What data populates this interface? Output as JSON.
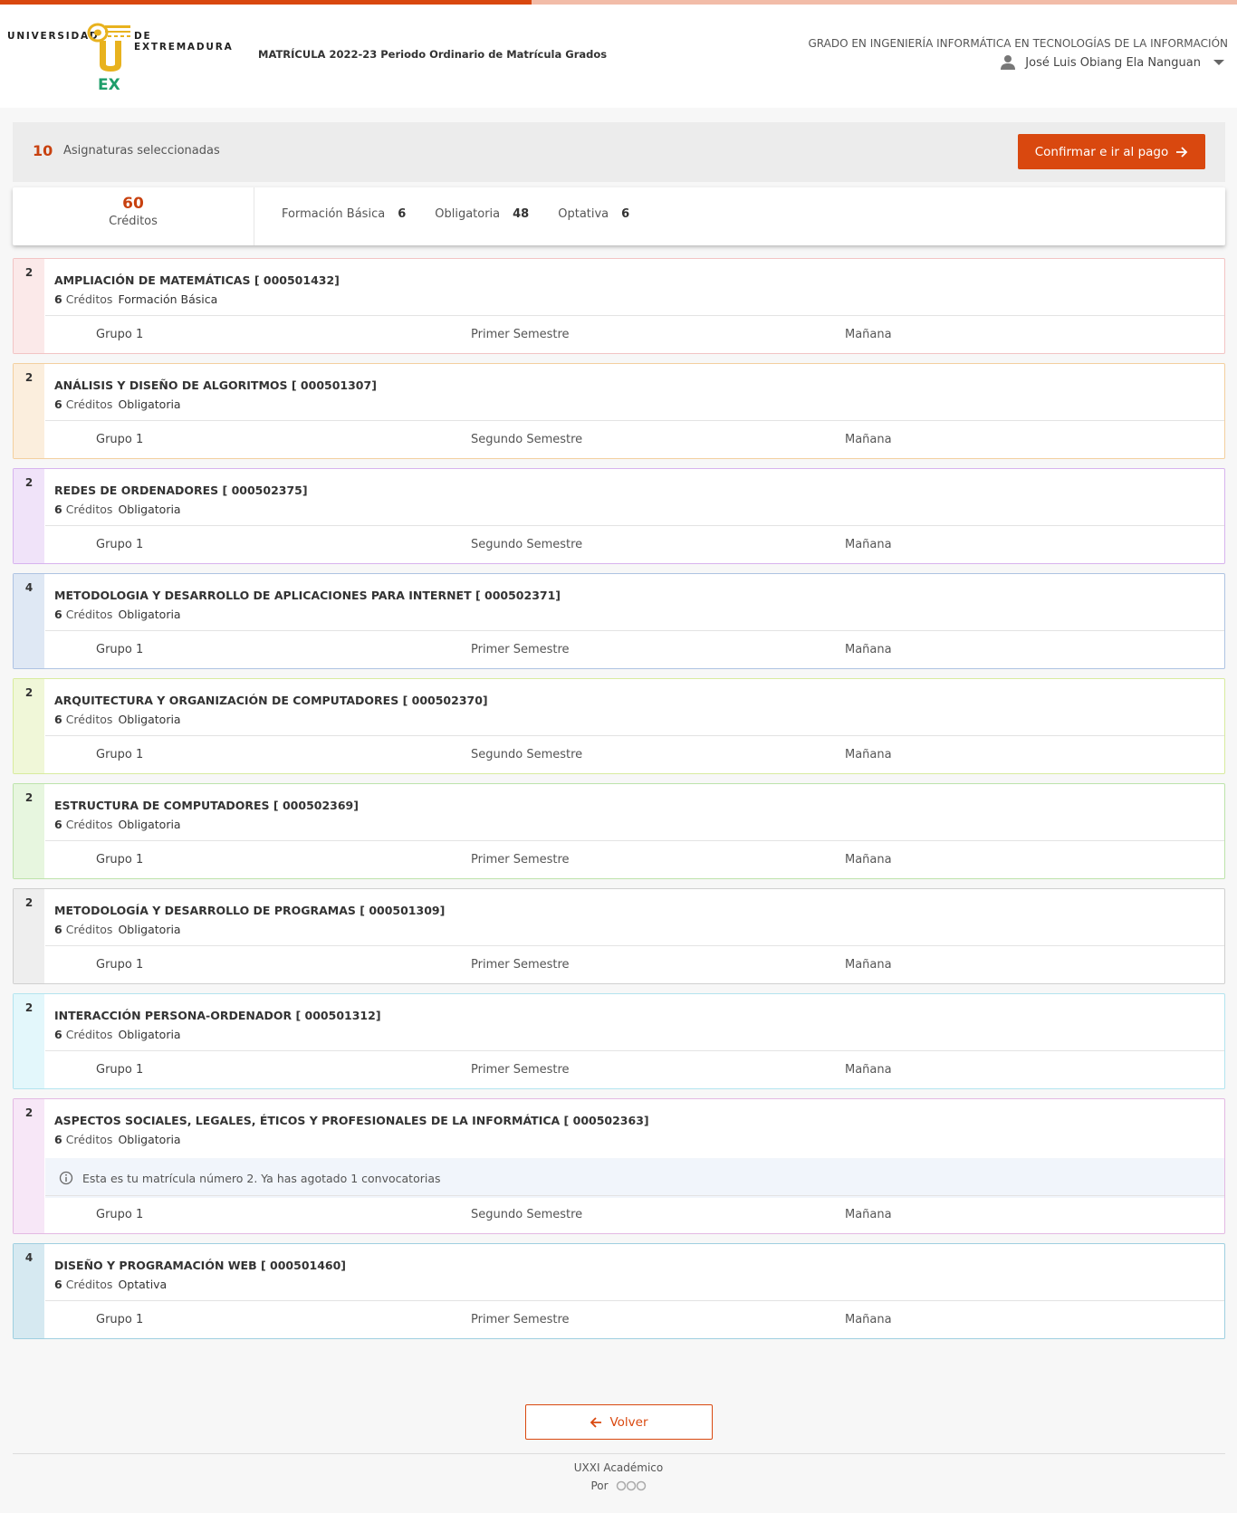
{
  "header": {
    "university_left": "UNIVERSIDAD",
    "university_right": "DE EXTREMADURA",
    "logo_letters": "EX",
    "matricula_title": "MATRÍCULA 2022-23 Periodo Ordinario de Matrícula Grados",
    "degree": "GRADO EN INGENIERÍA INFORMÁTICA EN TECNOLOGÍAS DE LA INFORMACIÓN",
    "user_name": "José Luis Obiang Ela Nanguan",
    "progress_fraction": 0.43
  },
  "summary": {
    "selected_count": "10",
    "selected_label": "Asignaturas seleccionadas",
    "confirm_label": "Confirmar e ir al pago"
  },
  "credits": {
    "total": "60",
    "total_label": "Créditos",
    "types": [
      {
        "label": "Formación Básica",
        "value": "6"
      },
      {
        "label": "Obligatoria",
        "value": "48"
      },
      {
        "label": "Optativa",
        "value": "6"
      }
    ]
  },
  "courses": [
    {
      "year": "2",
      "title": "AMPLIACIÓN DE MATEMÁTICAS [ 000501432]",
      "credits": "6",
      "credits_label": "Créditos",
      "type": "Formación Básica",
      "group": "Grupo 1",
      "semester": "Primer Semestre",
      "shift": "Mañana",
      "stripe_color": "#fbe9e9",
      "border_color": "#f2c4c4"
    },
    {
      "year": "2",
      "title": "ANÁLISIS Y DISEÑO DE ALGORITMOS [ 000501307]",
      "credits": "6",
      "credits_label": "Créditos",
      "type": "Obligatoria",
      "group": "Grupo 1",
      "semester": "Segundo Semestre",
      "shift": "Mañana",
      "stripe_color": "#fbeedd",
      "border_color": "#f3cf9f"
    },
    {
      "year": "2",
      "title": "REDES DE ORDENADORES [ 000502375]",
      "credits": "6",
      "credits_label": "Créditos",
      "type": "Obligatoria",
      "group": "Grupo 1",
      "semester": "Segundo Semestre",
      "shift": "Mañana",
      "stripe_color": "#f0e3f9",
      "border_color": "#d7b3ee"
    },
    {
      "year": "4",
      "title": "METODOLOGIA Y DESARROLLO DE APLICACIONES PARA INTERNET [ 000502371]",
      "credits": "6",
      "credits_label": "Créditos",
      "type": "Obligatoria",
      "group": "Grupo 1",
      "semester": "Primer Semestre",
      "shift": "Mañana",
      "stripe_color": "#dfe8f4",
      "border_color": "#aec3e2"
    },
    {
      "year": "2",
      "title": "ARQUITECTURA Y ORGANIZACIÓN DE COMPUTADORES [ 000502370]",
      "credits": "6",
      "credits_label": "Créditos",
      "type": "Obligatoria",
      "group": "Grupo 1",
      "semester": "Segundo Semestre",
      "shift": "Mañana",
      "stripe_color": "#f0f7d8",
      "border_color": "#d8eb9e"
    },
    {
      "year": "2",
      "title": "ESTRUCTURA DE COMPUTADORES [ 000502369]",
      "credits": "6",
      "credits_label": "Créditos",
      "type": "Obligatoria",
      "group": "Grupo 1",
      "semester": "Primer Semestre",
      "shift": "Mañana",
      "stripe_color": "#e7f6df",
      "border_color": "#bde3ab"
    },
    {
      "year": "2",
      "title": "METODOLOGÍA Y DESARROLLO DE PROGRAMAS [ 000501309]",
      "credits": "6",
      "credits_label": "Créditos",
      "type": "Obligatoria",
      "group": "Grupo 1",
      "semester": "Primer Semestre",
      "shift": "Mañana",
      "stripe_color": "#eeeeee",
      "border_color": "#cfcfcf"
    },
    {
      "year": "2",
      "title": "INTERACCIÓN PERSONA-ORDENADOR [ 000501312]",
      "credits": "6",
      "credits_label": "Créditos",
      "type": "Obligatoria",
      "group": "Grupo 1",
      "semester": "Primer Semestre",
      "shift": "Mañana",
      "stripe_color": "#e3f7fb",
      "border_color": "#b3e4ef"
    },
    {
      "year": "2",
      "title": "ASPECTOS SOCIALES, LEGALES, ÉTICOS Y PROFESIONALES DE LA INFORMÁTICA [ 000502363]",
      "credits": "6",
      "credits_label": "Créditos",
      "type": "Obligatoria",
      "notice": "Esta es tu matrícula número 2. Ya has agotado 1 convocatorias",
      "group": "Grupo 1",
      "semester": "Segundo Semestre",
      "shift": "Mañana",
      "stripe_color": "#f7e7f7",
      "border_color": "#e3b9e3"
    },
    {
      "year": "4",
      "title": "DISEÑO Y PROGRAMACIÓN WEB [ 000501460]",
      "credits": "6",
      "credits_label": "Créditos",
      "type": "Optativa",
      "group": "Grupo 1",
      "semester": "Primer Semestre",
      "shift": "Mañana",
      "stripe_color": "#d6e9f1",
      "border_color": "#9fcfe0"
    }
  ],
  "footer": {
    "back_label": "Volver",
    "app_name": "UXXI Académico",
    "by_label": "Por"
  },
  "colors": {
    "accent": "#d9480f",
    "accent_text": "#c8410f",
    "logo_gold": "#e8b21e",
    "logo_green": "#1e9e6a"
  }
}
